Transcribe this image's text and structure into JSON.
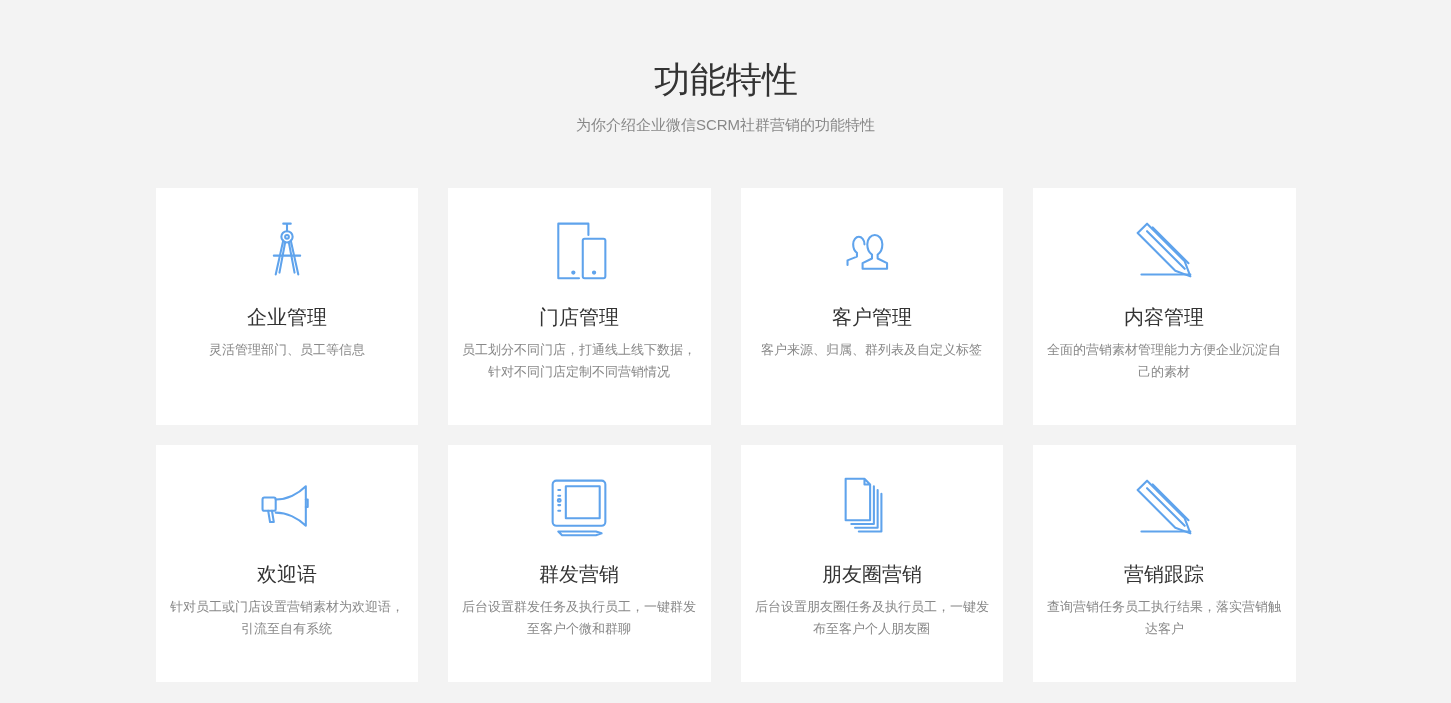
{
  "header": {
    "title": "功能特性",
    "subtitle": "为你介绍企业微信SCRM社群营销的功能特性"
  },
  "features": [
    {
      "kind": "compass",
      "title": "企业管理",
      "description": "灵活管理部门、员工等信息"
    },
    {
      "kind": "devices",
      "title": "门店管理",
      "description": "员工划分不同门店，打通线上线下数据，针对不同门店定制不同营销情况"
    },
    {
      "kind": "users",
      "title": "客户管理",
      "description": "客户来源、归属、群列表及自定义标签"
    },
    {
      "kind": "pencil",
      "title": "内容管理",
      "description": "全面的营销素材管理能力方便企业沉淀自己的素材"
    },
    {
      "kind": "megaphone",
      "title": "欢迎语",
      "description": "针对员工或门店设置营销素材为欢迎语，引流至自有系统"
    },
    {
      "kind": "tablet",
      "title": "群发营销",
      "description": "后台设置群发任务及执行员工，一键群发至客户个微和群聊"
    },
    {
      "kind": "documents",
      "title": "朋友圈营销",
      "description": "后台设置朋友圈任务及执行员工，一键发布至客户个人朋友圈"
    },
    {
      "kind": "pencil",
      "title": "营销跟踪",
      "description": "查询营销任务员工执行结果，落实营销触达客户"
    }
  ]
}
